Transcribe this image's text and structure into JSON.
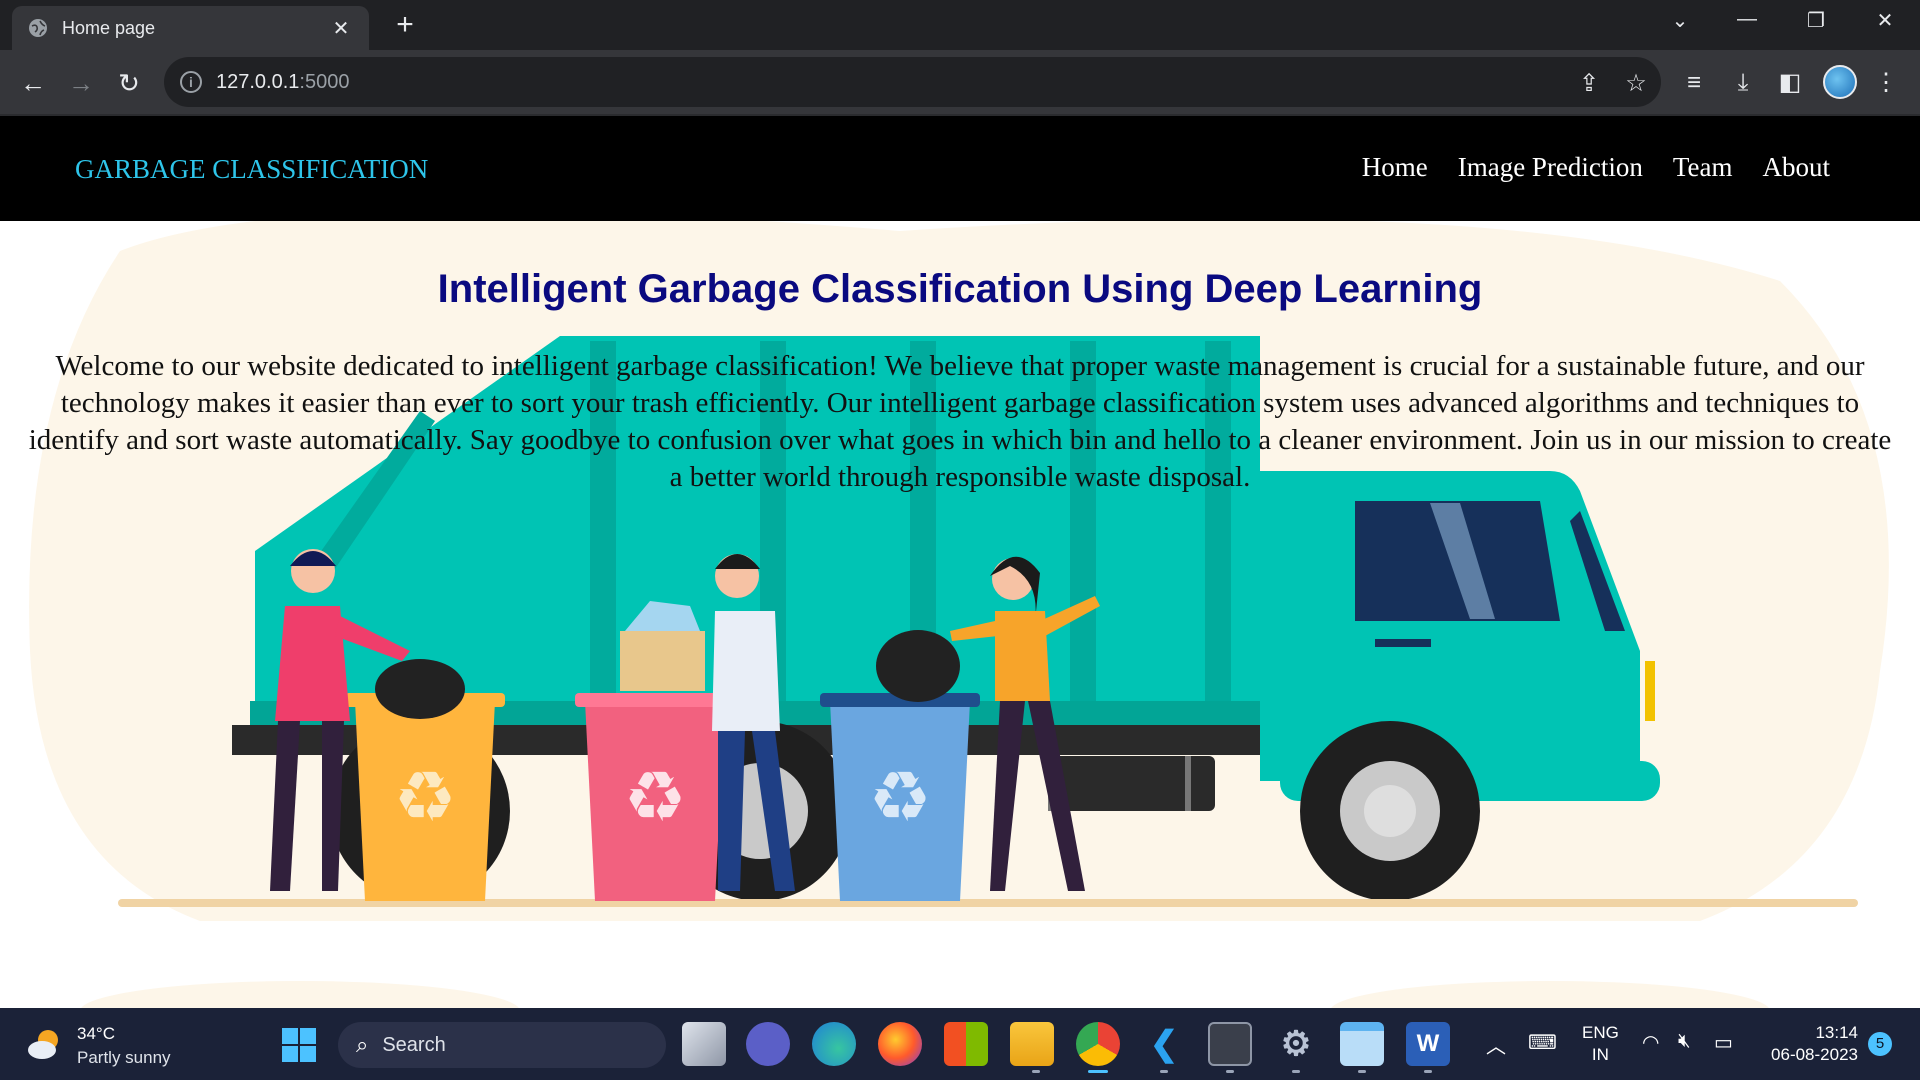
{
  "browser": {
    "tab_title": "Home page",
    "tab_close": "✕",
    "new_tab": "+",
    "url_host": "127.0.0.1",
    "url_port": ":5000",
    "window_controls": [
      "minimize",
      "restore",
      "close"
    ]
  },
  "site": {
    "brand": "GARBAGE CLASSIFICATION",
    "nav": [
      "Home",
      "Image Prediction",
      "Team",
      "About"
    ],
    "heading": "Intelligent Garbage Classification Using Deep Learning",
    "intro": "Welcome to our website dedicated to intelligent garbage classification! We believe that proper waste management is crucial for a sustainable future, and our technology makes it easier than ever to sort your trash efficiently. Our intelligent garbage classification system uses advanced algorithms and techniques to identify and sort waste automatically. Say goodbye to confusion over what goes in which bin and hello to a cleaner environment. Join us in our mission to create a better world through responsible waste disposal.",
    "colors": {
      "brand": "#2ec5ea",
      "heading": "#0a0a80",
      "truck": "#00c4b4",
      "bin_yellow": "#ffb53d",
      "bin_pink": "#f2617f",
      "bin_blue": "#6aa6e0"
    }
  },
  "taskbar": {
    "temperature": "34°C",
    "condition": "Partly sunny",
    "search_label": "Search",
    "language": "ENG",
    "region": "IN",
    "time": "13:14",
    "date": "06-08-2023",
    "notifications": "5",
    "apps": [
      "task-view",
      "teams-meet",
      "edge",
      "firefox",
      "microsoft-store",
      "file-explorer",
      "chrome",
      "vscode",
      "terminal",
      "settings",
      "notepad",
      "word"
    ]
  }
}
